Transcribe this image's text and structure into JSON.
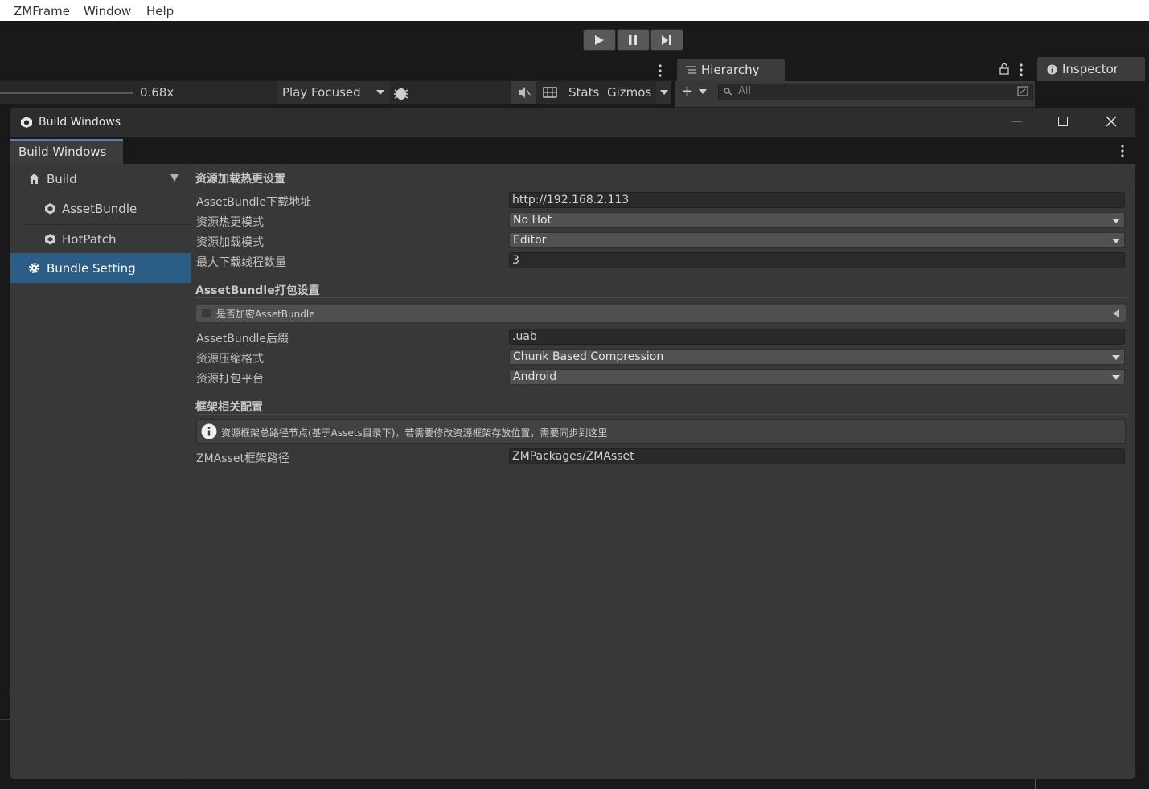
{
  "menu": [
    "ZMFrame",
    "Window",
    "Help"
  ],
  "gameview": {
    "scale": "0.68x",
    "play_mode": "Play Focused",
    "stats": "Stats",
    "gizmos": "Gizmos"
  },
  "hierarchy": {
    "tab": "Hierarchy",
    "search_placeholder": "All"
  },
  "inspector": {
    "tab": "Inspector"
  },
  "window": {
    "title": "Build Windows",
    "tab": "Build Windows"
  },
  "sidebar": {
    "items": [
      {
        "label": "Build"
      },
      {
        "label": "AssetBundle"
      },
      {
        "label": "HotPatch"
      },
      {
        "label": "Bundle Setting"
      }
    ]
  },
  "sections": {
    "load": {
      "title": "资源加载热更设置",
      "rows": [
        {
          "label": "AssetBundle下载地址",
          "value": "http://192.168.2.113"
        },
        {
          "label": "资源热更模式",
          "value": "No Hot"
        },
        {
          "label": "资源加载模式",
          "value": "Editor"
        },
        {
          "label": "最大下载线程数量",
          "value": "3"
        }
      ]
    },
    "pack": {
      "title": "AssetBundle打包设置",
      "encrypt": "是否加密AssetBundle",
      "rows": [
        {
          "label": "AssetBundle后缀",
          "value": ".uab"
        },
        {
          "label": "资源压缩格式",
          "value": "Chunk Based Compression"
        },
        {
          "label": "资源打包平台",
          "value": "Android"
        }
      ]
    },
    "frame": {
      "title": "框架相关配置",
      "info": "资源框架总路径节点(基于Assets目录下)，若需要修改资源框架存放位置，需要同步到这里",
      "rows": [
        {
          "label": "ZMAsset框架路径",
          "value": "ZMPackages/ZMAsset"
        }
      ]
    }
  },
  "colors": {
    "accent": "#4c7fbd",
    "selected": "#2c5d87",
    "panel": "#383838",
    "field": "#2a2a2a"
  }
}
